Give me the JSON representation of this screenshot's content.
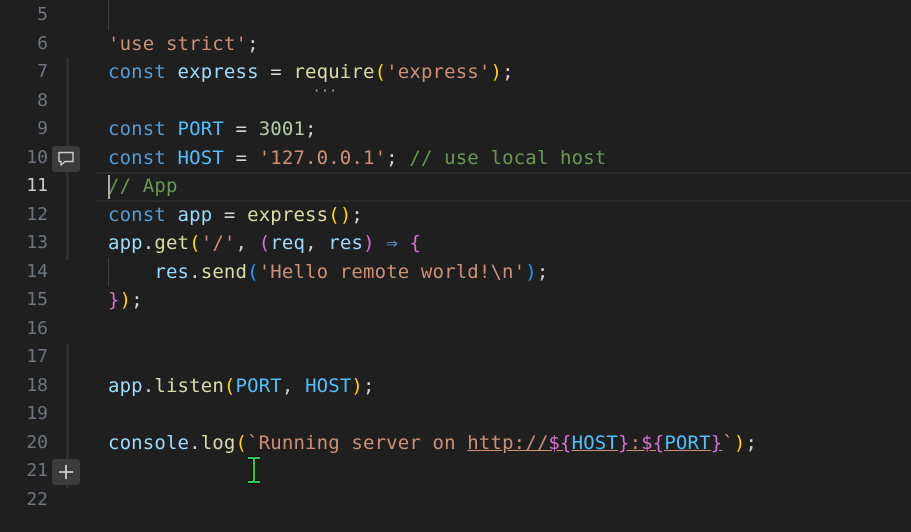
{
  "line_numbers": [
    "5",
    "6",
    "7",
    "8",
    "9",
    "10",
    "11",
    "12",
    "13",
    "14",
    "15",
    "16",
    "17",
    "18",
    "19",
    "20",
    "21",
    "22"
  ],
  "code": {
    "l6_str": "'use strict'",
    "l6_semi": ";",
    "l7_kw": "const",
    "l7_name": "express",
    "l7_eq": " = ",
    "l7_fn": "require",
    "l7_p1": "(",
    "l7_str": "'express'",
    "l7_p2": ")",
    "l7_semi": ";",
    "l9_kw": "const",
    "l9_name": "PORT",
    "l9_eq": " = ",
    "l9_num": "3001",
    "l9_semi": ";",
    "l10_kw": "const",
    "l10_name": "HOST",
    "l10_eq": " = ",
    "l10_str": "'127.0.0.1'",
    "l10_semi": "; ",
    "l10_cmt": "// use local host",
    "l11_cmt": "// App",
    "l12_kw": "const",
    "l12_name": "app",
    "l12_eq": " = ",
    "l12_fn": "express",
    "l12_parens": "()",
    "l12_semi": ";",
    "l13_obj": "app",
    "l13_dot": ".",
    "l13_fn": "get",
    "l13_p1": "(",
    "l13_str": "'/'",
    "l13_comma": ", ",
    "l13_p2": "(",
    "l13_req": "req",
    "l13_comma2": ", ",
    "l13_res": "res",
    "l13_p3": ")",
    "l13_arrow": " ⇒ ",
    "l13_brace": "{",
    "l14_indent": "    ",
    "l14_obj": "res",
    "l14_dot": ".",
    "l14_fn": "send",
    "l14_p1": "(",
    "l14_str": "'Hello remote world!\\n'",
    "l14_p2": ")",
    "l14_semi": ";",
    "l15_brace": "}",
    "l15_paren": ")",
    "l15_semi": ";",
    "l18_obj": "app",
    "l18_dot": ".",
    "l18_fn": "listen",
    "l18_p1": "(",
    "l18_a1": "PORT",
    "l18_comma": ", ",
    "l18_a2": "HOST",
    "l18_p2": ")",
    "l18_semi": ";",
    "l20_obj": "console",
    "l20_dot": ".",
    "l20_fn": "log",
    "l20_p1": "(",
    "l20_str": "`Running server on ",
    "l20_url": "http://",
    "l20_t1o": "${",
    "l20_host": "HOST",
    "l20_t1c": "}",
    "l20_colon": ":",
    "l20_t2o": "${",
    "l20_port": "PORT",
    "l20_t2c": "}",
    "l20_tick": "`",
    "l20_p2": ")",
    "l20_semi": ";"
  },
  "gutter": {
    "comment_button_icon": "comment-icon",
    "add_button_icon": "plus-icon"
  },
  "colors": {
    "background": "#1f1f1f",
    "keyword": "#569cd6",
    "variable": "#9cdcfe",
    "constant": "#4fc1ff",
    "function": "#dcdcaa",
    "string": "#ce9178",
    "number": "#b5cea8",
    "comment": "#6a9955"
  }
}
